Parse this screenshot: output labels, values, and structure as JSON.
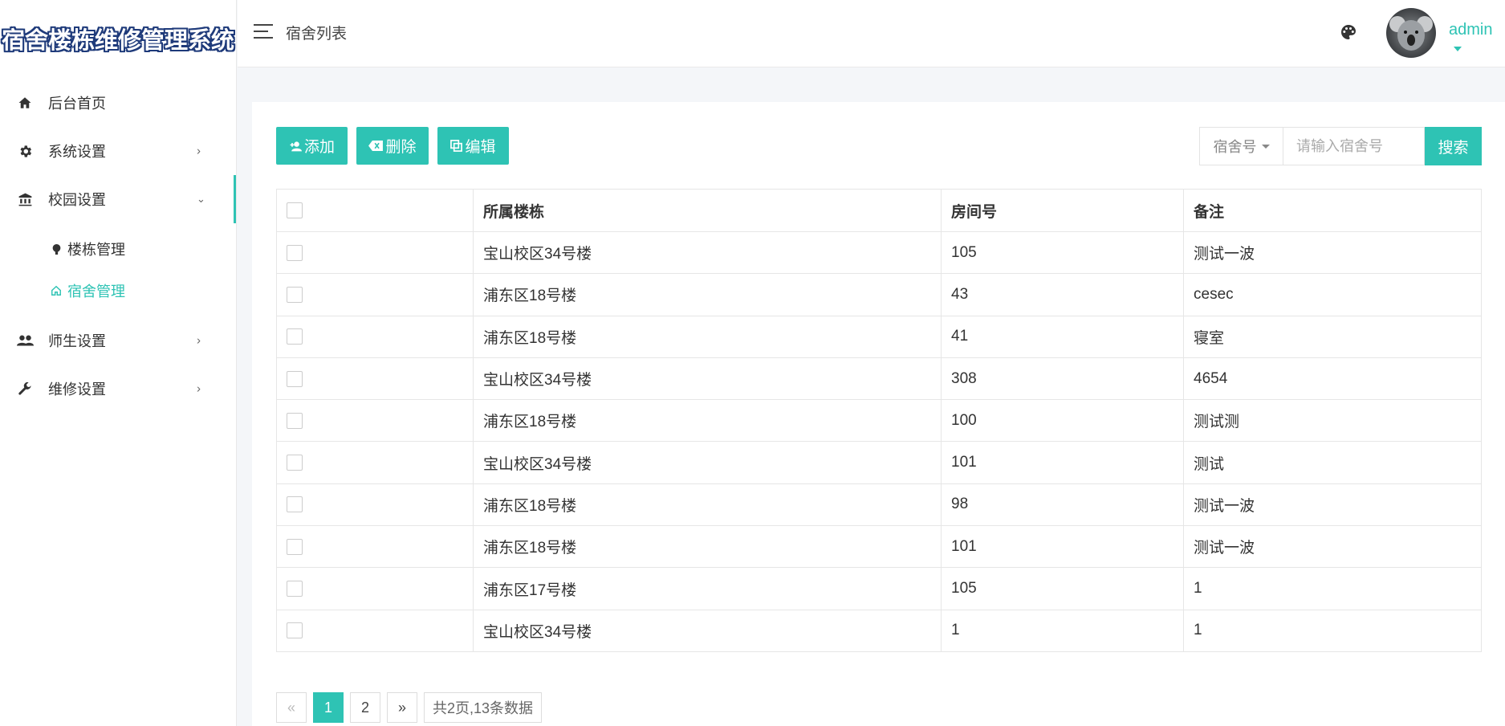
{
  "app": {
    "title": "宿舍楼栋维修管理系统"
  },
  "sidebar": {
    "items": [
      {
        "label": "后台首页",
        "icon": "home-icon"
      },
      {
        "label": "系统设置",
        "icon": "gear-icon"
      },
      {
        "label": "校园设置",
        "icon": "bank-icon"
      },
      {
        "label": "师生设置",
        "icon": "people-icon"
      },
      {
        "label": "维修设置",
        "icon": "wrench-icon"
      }
    ],
    "sub_items": [
      {
        "label": "楼栋管理",
        "icon": "pin-icon"
      },
      {
        "label": "宿舍管理",
        "icon": "house-icon"
      }
    ]
  },
  "header": {
    "page_title": "宿舍列表",
    "user": "admin"
  },
  "toolbar": {
    "add_label": "添加",
    "delete_label": "删除",
    "edit_label": "编辑",
    "search_type": "宿舍号",
    "search_placeholder": "请输入宿舍号",
    "search_label": "搜索"
  },
  "table": {
    "headers": [
      "所属楼栋",
      "房间号",
      "备注"
    ],
    "rows": [
      {
        "building": "宝山校区34号楼",
        "room": "105",
        "note": "测试一波"
      },
      {
        "building": "浦东区18号楼",
        "room": "43",
        "note": "cesec"
      },
      {
        "building": "浦东区18号楼",
        "room": "41",
        "note": "寝室"
      },
      {
        "building": "宝山校区34号楼",
        "room": "308",
        "note": "4654"
      },
      {
        "building": "浦东区18号楼",
        "room": "100",
        "note": "测试测"
      },
      {
        "building": "宝山校区34号楼",
        "room": "101",
        "note": "测试"
      },
      {
        "building": "浦东区18号楼",
        "room": "98",
        "note": "测试一波"
      },
      {
        "building": "浦东区18号楼",
        "room": "101",
        "note": "测试一波"
      },
      {
        "building": "浦东区17号楼",
        "room": "105",
        "note": "1"
      },
      {
        "building": "宝山校区34号楼",
        "room": "1",
        "note": "1"
      }
    ]
  },
  "pagination": {
    "prev": "«",
    "pages": [
      "1",
      "2"
    ],
    "next": "»",
    "info": "共2页,13条数据"
  },
  "colors": {
    "accent": "#2ec3b4"
  }
}
